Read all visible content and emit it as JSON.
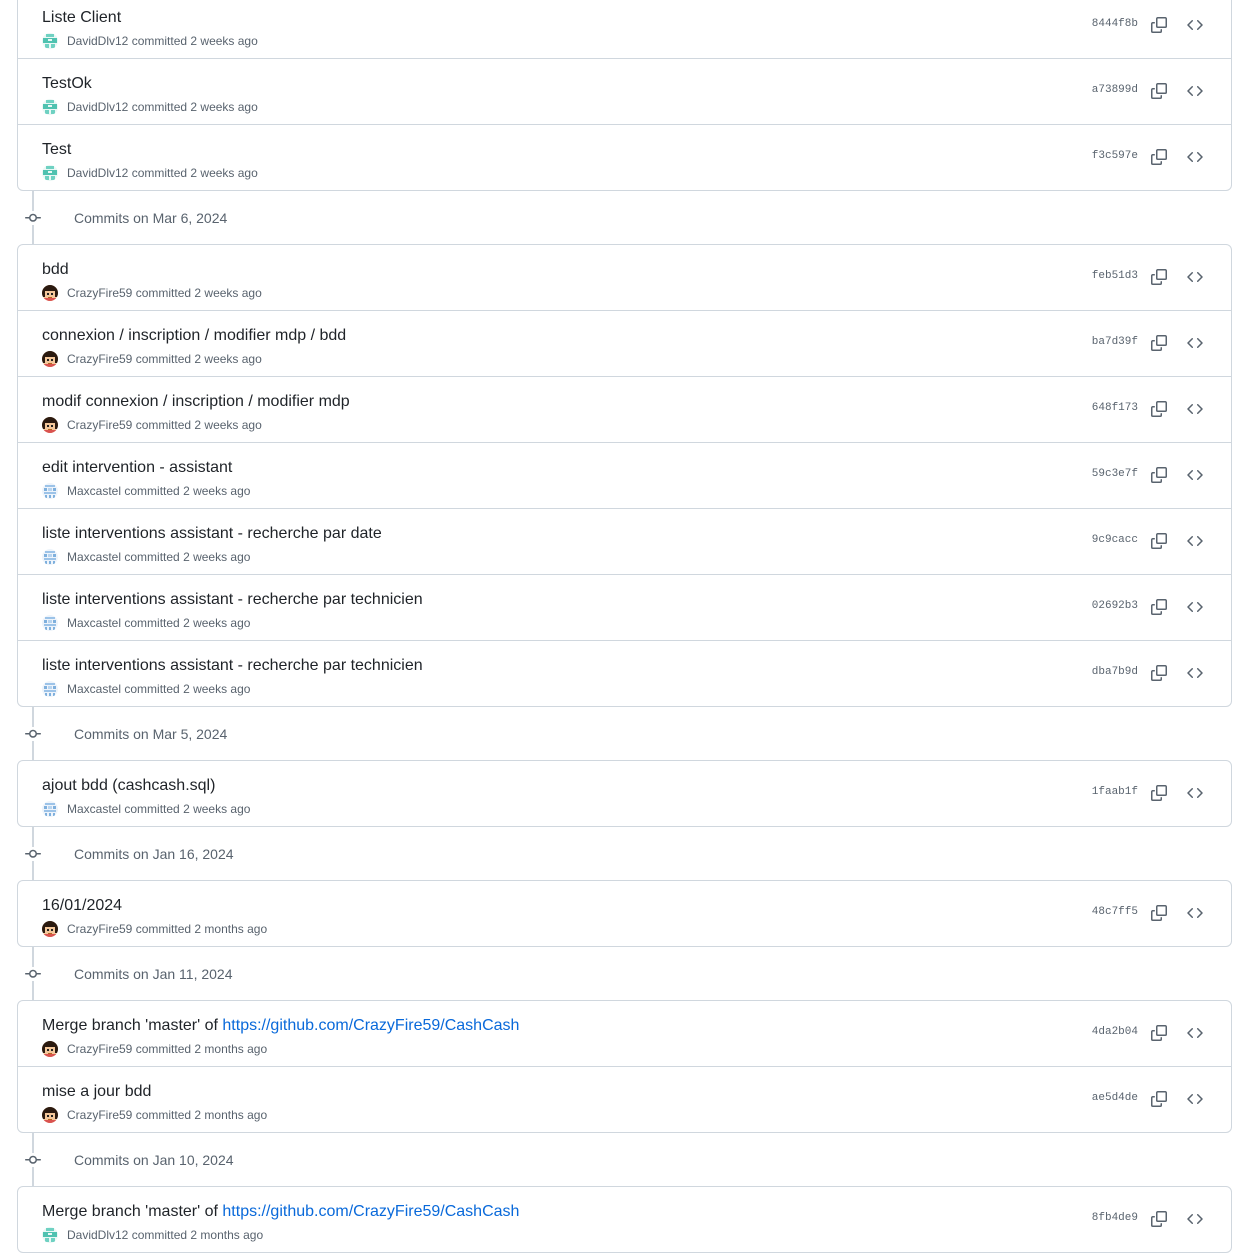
{
  "groups": [
    {
      "header": null,
      "commits": [
        {
          "message": "Liste Client",
          "author": "DavidDlv12",
          "committed_text": "committed",
          "time": "2 weeks ago",
          "sha": "8444f8b",
          "avatar": "david"
        },
        {
          "message": "TestOk",
          "author": "DavidDlv12",
          "committed_text": "committed",
          "time": "2 weeks ago",
          "sha": "a73899d",
          "avatar": "david"
        },
        {
          "message": "Test",
          "author": "DavidDlv12",
          "committed_text": "committed",
          "time": "2 weeks ago",
          "sha": "f3c597e",
          "avatar": "david"
        }
      ]
    },
    {
      "header": "Commits on Mar 6, 2024",
      "commits": [
        {
          "message": "bdd",
          "author": "CrazyFire59",
          "committed_text": "committed",
          "time": "2 weeks ago",
          "sha": "feb51d3",
          "avatar": "crazy"
        },
        {
          "message": "connexion / inscription / modifier mdp / bdd",
          "author": "CrazyFire59",
          "committed_text": "committed",
          "time": "2 weeks ago",
          "sha": "ba7d39f",
          "avatar": "crazy"
        },
        {
          "message": "modif connexion / inscription / modifier mdp",
          "author": "CrazyFire59",
          "committed_text": "committed",
          "time": "2 weeks ago",
          "sha": "648f173",
          "avatar": "crazy"
        },
        {
          "message": "edit intervention - assistant",
          "author": "Maxcastel",
          "committed_text": "committed",
          "time": "2 weeks ago",
          "sha": "59c3e7f",
          "avatar": "max"
        },
        {
          "message": "liste interventions assistant - recherche par date",
          "author": "Maxcastel",
          "committed_text": "committed",
          "time": "2 weeks ago",
          "sha": "9c9cacc",
          "avatar": "max"
        },
        {
          "message": "liste interventions assistant - recherche par technicien",
          "author": "Maxcastel",
          "committed_text": "committed",
          "time": "2 weeks ago",
          "sha": "02692b3",
          "avatar": "max"
        },
        {
          "message": "liste interventions assistant - recherche par technicien",
          "author": "Maxcastel",
          "committed_text": "committed",
          "time": "2 weeks ago",
          "sha": "dba7b9d",
          "avatar": "max"
        }
      ]
    },
    {
      "header": "Commits on Mar 5, 2024",
      "commits": [
        {
          "message": "ajout bdd (cashcash.sql)",
          "author": "Maxcastel",
          "committed_text": "committed",
          "time": "2 weeks ago",
          "sha": "1faab1f",
          "avatar": "max"
        }
      ]
    },
    {
      "header": "Commits on Jan 16, 2024",
      "commits": [
        {
          "message": "16/01/2024",
          "author": "CrazyFire59",
          "committed_text": "committed",
          "time": "2 months ago",
          "sha": "48c7ff5",
          "avatar": "crazy"
        }
      ]
    },
    {
      "header": "Commits on Jan 11, 2024",
      "commits": [
        {
          "message": "Merge branch 'master' of ",
          "link": "https://github.com/CrazyFire59/CashCash",
          "author": "CrazyFire59",
          "committed_text": "committed",
          "time": "2 months ago",
          "sha": "4da2b04",
          "avatar": "crazy"
        },
        {
          "message": "mise a jour bdd",
          "author": "CrazyFire59",
          "committed_text": "committed",
          "time": "2 months ago",
          "sha": "ae5d4de",
          "avatar": "crazy"
        }
      ]
    },
    {
      "header": "Commits on Jan 10, 2024",
      "commits": [
        {
          "message": "Merge branch 'master' of ",
          "link": "https://github.com/CrazyFire59/CashCash",
          "author": "DavidDlv12",
          "committed_text": "committed",
          "time": "2 months ago",
          "sha": "8fb4de9",
          "avatar": "david"
        }
      ]
    }
  ],
  "icons": {
    "copy": "copy-icon",
    "browse": "code-icon",
    "node": "git-commit-icon"
  },
  "colors": {
    "border": "#d0d7de",
    "muted": "#59636e",
    "link": "#0969da",
    "text": "#1f2328"
  }
}
